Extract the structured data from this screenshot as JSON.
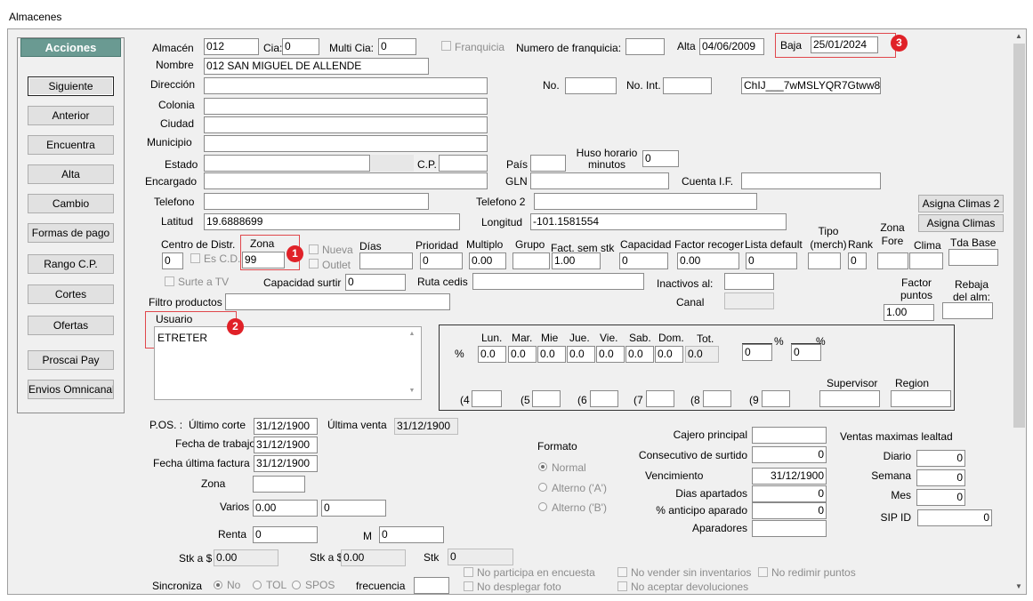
{
  "window_title": "Almacenes",
  "actions": {
    "header": "Acciones",
    "buttons": [
      "Siguiente",
      "Anterior",
      "Encuentra",
      "Alta",
      "Cambio",
      "Formas de pago",
      "Rango C.P.",
      "Cortes",
      "Ofertas",
      "Proscai Pay",
      "Envios Omnicanal"
    ]
  },
  "side_buttons": [
    "Asigna Climas 2",
    "Asigna Climas"
  ],
  "labels": {
    "almacen": "Almacén",
    "cia": "Cia:",
    "multi_cia": "Multi Cia:",
    "franquicia": "Franquicia",
    "num_franquicia": "Numero de franquicia:",
    "alta": "Alta",
    "baja": "Baja",
    "nombre": "Nombre",
    "direccion": "Dirección",
    "no": "No.",
    "no_int": "No. Int.",
    "colonia": "Colonia",
    "ciudad": "Ciudad",
    "municipio": "Municipio",
    "estado": "Estado",
    "cp": "C.P.",
    "pais": "País",
    "huso": "Huso horario minutos",
    "encargado": "Encargado",
    "gln": "GLN",
    "cuenta_if": "Cuenta I.F.",
    "telefono": "Telefono",
    "telefono2": "Telefono 2",
    "latitud": "Latitud",
    "longitud": "Longitud",
    "centro": "Centro de Distr.",
    "zona": "Zona",
    "nueva": "Nueva",
    "outlet": "Outlet",
    "es_cd": "Es C.D.",
    "dias": "Días",
    "prioridad": "Prioridad",
    "multiplo": "Multiplo",
    "grupo": "Grupo",
    "fact_sem": "Fact. sem stk",
    "capacidad": "Capacidad",
    "factor_recoger": "Factor recoger",
    "lista_default": "Lista default",
    "tipo_merch": "Tipo (merch)",
    "rank": "Rank",
    "zona_fore": "Zona Fore",
    "clima": "Clima",
    "tda_base": "Tda Base",
    "surte_tv": "Surte a TV",
    "capacidad_surtir": "Capacidad surtir",
    "ruta_cedis": "Ruta cedis",
    "inactivos": "Inactivos al:",
    "factor_puntos": "Factor puntos",
    "rebaja": "Rebaja del alm:",
    "filtro": "Filtro productos",
    "canal": "Canal",
    "usuario": "Usuario",
    "pct": "%",
    "lun": "Lun.",
    "mar": "Mar.",
    "mie": "Mie",
    "jue": "Jue.",
    "vie": "Vie.",
    "sab": "Sab.",
    "dom": "Dom.",
    "tot": "Tot.",
    "g4": "(4",
    "g5": "(5",
    "g6": "(6",
    "g7": "(7",
    "g8": "(8",
    "g9": "(9",
    "supervisor": "Supervisor",
    "region": "Region",
    "pos": "P.OS. :",
    "ultimo_corte": "Último corte",
    "ultima_venta": "Última venta",
    "fecha_trabajo": "Fecha de trabajo",
    "fecha_ult_factura": "Fecha última factura",
    "zona2": "Zona",
    "varios": "Varios",
    "renta": "Renta",
    "m": "M",
    "stk_a1": "Stk a $",
    "stk_a2": "Stk a $",
    "stk": "Stk",
    "formato": "Formato",
    "normal": "Normal",
    "alterno_a": "Alterno ('A')",
    "alterno_b": "Alterno ('B')",
    "cajero": "Cajero principal",
    "consecutivo": "Consecutivo de surtido",
    "vencimiento": "Vencimiento",
    "dias_apartados": "Dias apartados",
    "anticipo": "% anticipo aparado",
    "aparadores": "Aparadores",
    "ventas_max": "Ventas maximas lealtad",
    "diario": "Diario",
    "semana": "Semana",
    "mes": "Mes",
    "sip": "SIP ID",
    "sincroniza": "Sincroniza",
    "no_opt": "No",
    "tol": "TOL",
    "spos": "SPOS",
    "frecuencia": "frecuencia",
    "no_participa": "No participa en encuesta",
    "no_foto": "No desplegar foto",
    "no_vender": "No vender sin inventarios",
    "no_aceptar": "No aceptar devoluciones",
    "no_redimir": "No redimir puntos"
  },
  "values": {
    "almacen": "012",
    "cia": "0",
    "multi_cia": "0",
    "alta": "04/06/2009",
    "baja": "25/01/2024",
    "nombre": "012 SAN MIGUEL DE ALLENDE",
    "place_id": "ChIJ___7wMSLYQR7Gtww8r.",
    "huso": "0",
    "latitud": "19.6888699",
    "longitud": "-101.1581554",
    "centro": "0",
    "zona": "99",
    "prioridad": "0",
    "multiplo": "0.00",
    "fact_sem": "1.00",
    "capacidad": "0",
    "factor_recoger": "0.00",
    "lista_default": "0",
    "rank": "0",
    "capacidad_surtir": "0",
    "factor_puntos": "1.00",
    "usuario": "ETRETER",
    "pct_days": [
      "0.0",
      "0.0",
      "0.0",
      "0.0",
      "0.0",
      "0.0",
      "0.0"
    ],
    "tot": "0.0",
    "pct1": "0",
    "pct2": "0",
    "ultimo_corte": "31/12/1900",
    "ultima_venta": "31/12/1900",
    "fecha_trabajo": "31/12/1900",
    "fecha_ult_factura": "31/12/1900",
    "varios1": "0.00",
    "varios2": "0",
    "renta": "0",
    "m": "0",
    "stk_a1": "0.00",
    "stk_a2": "0.00",
    "stk": "0",
    "consecutivo": "0",
    "vencimiento": "31/12/1900",
    "dias_apartados": "0",
    "anticipo": "0",
    "diario": "0",
    "semana": "0",
    "mes": "0",
    "sip": "0"
  },
  "badges": [
    "1",
    "2",
    "3"
  ],
  "icons": {
    "scroll_up": "▲",
    "scroll_down": "▼"
  }
}
